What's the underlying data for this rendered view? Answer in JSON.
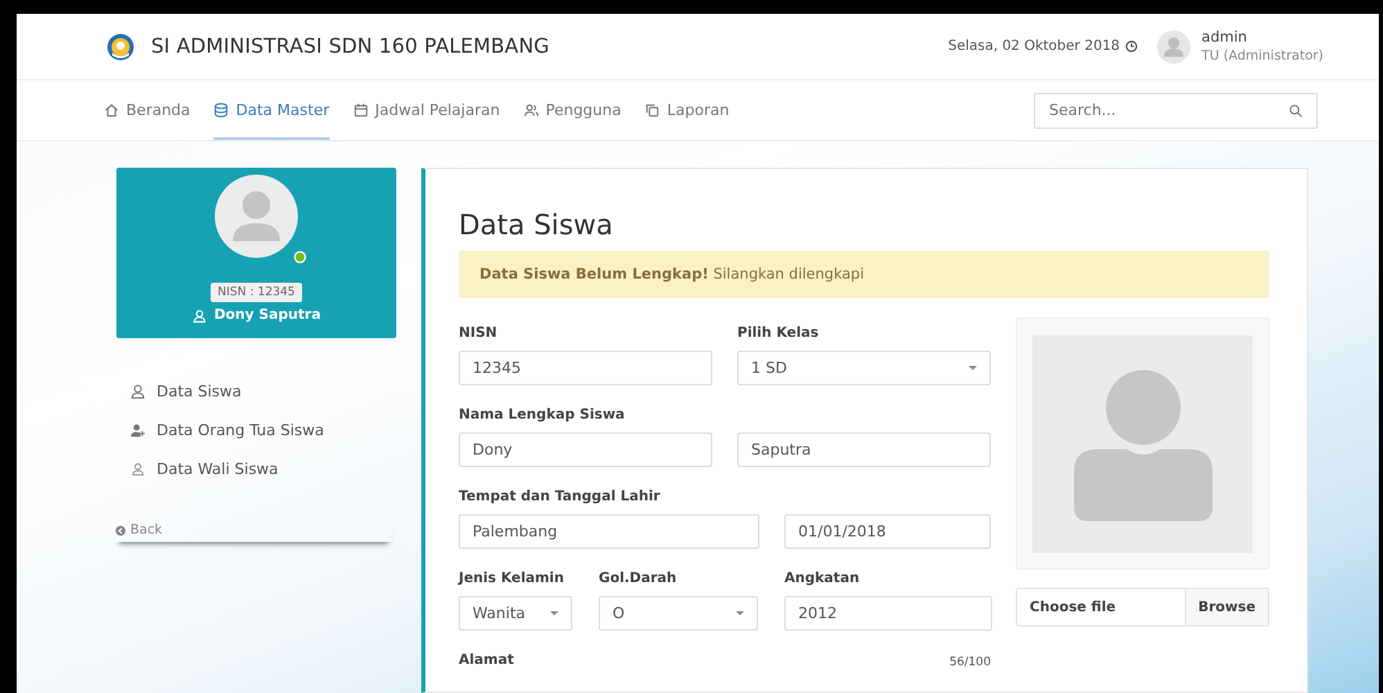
{
  "header": {
    "title": "SI ADMINISTRASI SDN 160 PALEMBANG",
    "date": "Selasa, 02 Oktober 2018",
    "user": {
      "name": "admin",
      "role": "TU (Administrator)"
    }
  },
  "nav": {
    "items": [
      {
        "label": "Beranda",
        "kind": "home",
        "selected": false
      },
      {
        "label": "Data Master",
        "kind": "database",
        "selected": true
      },
      {
        "label": "Jadwal Pelajaran",
        "kind": "calendar",
        "selected": false
      },
      {
        "label": "Pengguna",
        "kind": "users",
        "selected": false
      },
      {
        "label": "Laporan",
        "kind": "copy",
        "selected": false
      }
    ],
    "search": {
      "placeholder": "Search..."
    }
  },
  "sidebar": {
    "profile": {
      "nisn": "NISN : 12345",
      "name": "Dony Saputra",
      "online": true
    },
    "menu": [
      {
        "label": "Data Siswa",
        "kind": "user-outline"
      },
      {
        "label": "Data Orang Tua Siswa",
        "kind": "user-add"
      },
      {
        "label": "Data Wali Siswa",
        "kind": "user-thin"
      }
    ],
    "back": "Back"
  },
  "form": {
    "title": "Data Siswa",
    "alert": "**Data Siswa Belum Lengkap!** Silangkan dilengkapi",
    "nisn": {
      "label": "NISN",
      "value": "12345"
    },
    "kelas": {
      "label": "Pilih Kelas",
      "value": "1 SD"
    },
    "nama": {
      "label": "Nama Lengkap Siswa",
      "first": "Dony",
      "last": "Saputra"
    },
    "lahir": {
      "label": "Tempat dan Tanggal Lahir",
      "place": "Palembang",
      "date": "01/01/2018"
    },
    "jenis_kelamin": {
      "label": "Jenis Kelamin",
      "value": "Wanita"
    },
    "gol_darah": {
      "label": "Gol.Darah",
      "value": "O"
    },
    "angkatan": {
      "label": "Angkatan",
      "value": "2012"
    },
    "alamat": {
      "label": "Alamat",
      "counter": "56/100"
    },
    "photo": {
      "file_label": "Choose file",
      "button": "Browse"
    }
  }
}
